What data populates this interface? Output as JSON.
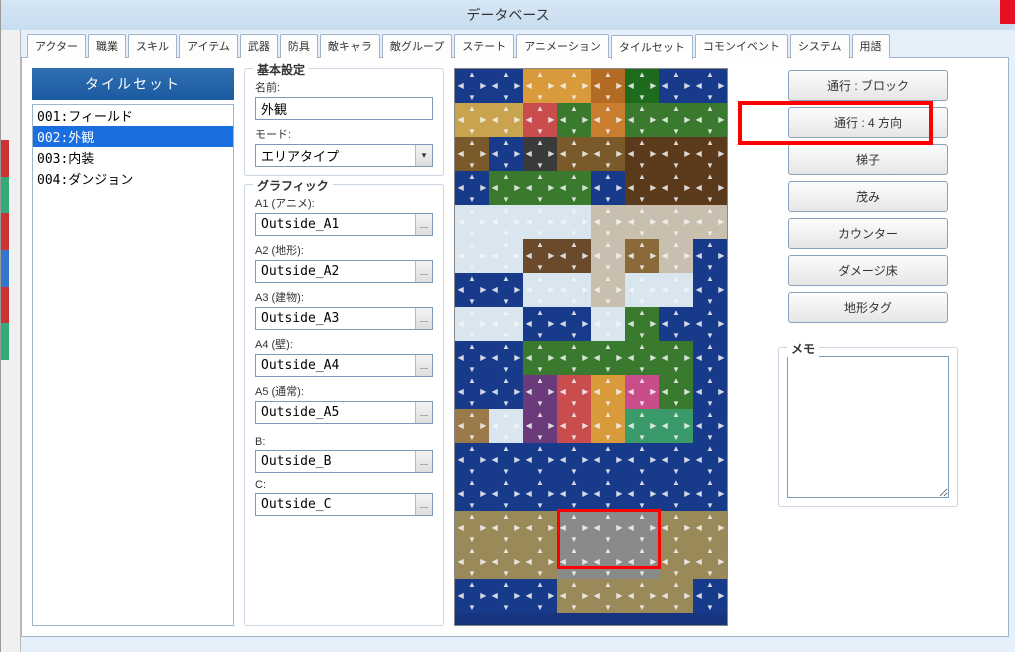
{
  "window": {
    "title": "データベース"
  },
  "tabs": {
    "items": [
      {
        "id": "actor",
        "label": "アクター"
      },
      {
        "id": "class",
        "label": "職業"
      },
      {
        "id": "skill",
        "label": "スキル"
      },
      {
        "id": "item",
        "label": "アイテム"
      },
      {
        "id": "weapon",
        "label": "武器"
      },
      {
        "id": "armor",
        "label": "防具"
      },
      {
        "id": "enemy",
        "label": "敵キャラ"
      },
      {
        "id": "troop",
        "label": "敵グループ"
      },
      {
        "id": "state",
        "label": "ステート"
      },
      {
        "id": "anim",
        "label": "アニメーション"
      },
      {
        "id": "tileset",
        "label": "タイルセット"
      },
      {
        "id": "common",
        "label": "コモンイベント"
      },
      {
        "id": "system",
        "label": "システム"
      },
      {
        "id": "terms",
        "label": "用語"
      }
    ],
    "active": "tileset"
  },
  "list": {
    "header": "タイルセット",
    "items": [
      {
        "id": "001",
        "label": "001:フィールド",
        "selected": false
      },
      {
        "id": "002",
        "label": "002:外観",
        "selected": true
      },
      {
        "id": "003",
        "label": "003:内装",
        "selected": false
      },
      {
        "id": "004",
        "label": "004:ダンジョン",
        "selected": false
      }
    ]
  },
  "basic": {
    "group_title": "基本設定",
    "name_label": "名前:",
    "name_value": "外観",
    "mode_label": "モード:",
    "mode_value": "エリアタイプ"
  },
  "graphic": {
    "group_title": "グラフィック",
    "fields": [
      {
        "label": "A1 (アニメ):",
        "value": "Outside_A1"
      },
      {
        "label": "A2 (地形):",
        "value": "Outside_A2"
      },
      {
        "label": "A3 (建物):",
        "value": "Outside_A3"
      },
      {
        "label": "A4 (壁):",
        "value": "Outside_A4"
      },
      {
        "label": "A5 (通常):",
        "value": "Outside_A5"
      },
      {
        "label": "B:",
        "value": "Outside_B"
      },
      {
        "label": "C:",
        "value": "Outside_C"
      }
    ]
  },
  "buttons": {
    "passage_block": "通行 : ブロック",
    "passage_4dir": "通行 : 4 方向",
    "ladder": "梯子",
    "bush": "茂み",
    "counter": "カウンター",
    "damage": "ダメージ床",
    "terrain": "地形タグ"
  },
  "memo": {
    "label": "メモ",
    "value": ""
  },
  "tile_palette": {
    "cols": 8,
    "rows": 16,
    "tiles": [
      [
        "#173a8a",
        "#173a8a",
        "#d89a3a",
        "#d89a3a",
        "#b36b23",
        "#1e6b1e",
        "#173a8a",
        "#173a8a"
      ],
      [
        "#c9a34d",
        "#c9a34d",
        "#c94d4d",
        "#3a7a2f",
        "#c97d2f",
        "#3a7a2f",
        "#3a7a2f",
        "#3a7a2f"
      ],
      [
        "#7a5a2a",
        "#173a8a",
        "#3a3a3a",
        "#7a5a2a",
        "#7a5a2a",
        "#5a3a1a",
        "#5a3a1a",
        "#5a3a1a"
      ],
      [
        "#173a8a",
        "#3a7a2f",
        "#3a7a2f",
        "#3a7a2f",
        "#173a8a",
        "#5a3a1a",
        "#5a3a1a",
        "#5a3a1a"
      ],
      [
        "#d9e6ef",
        "#d9e6ef",
        "#d9e6ef",
        "#d9e6ef",
        "#c9bfae",
        "#c9bfae",
        "#c9bfae",
        "#c9bfae"
      ],
      [
        "#d9e6ef",
        "#d9e6ef",
        "#6a4a2a",
        "#6a4a2a",
        "#c9bfae",
        "#8a6a3a",
        "#c9bfae",
        "#173a8a"
      ],
      [
        "#173a8a",
        "#173a8a",
        "#d9e6ef",
        "#d9e6ef",
        "#c9bfae",
        "#d9e6ef",
        "#d9e6ef",
        "#173a8a"
      ],
      [
        "#d9e6ef",
        "#d9e6ef",
        "#173a8a",
        "#173a8a",
        "#d9e6ef",
        "#3a7a2f",
        "#173a8a",
        "#173a8a"
      ],
      [
        "#173a8a",
        "#173a8a",
        "#3a7a2f",
        "#3a7a2f",
        "#3a7a2f",
        "#3a7a2f",
        "#3a7a2f",
        "#173a8a"
      ],
      [
        "#173a8a",
        "#173a8a",
        "#6a3a7a",
        "#c94d4d",
        "#d89a3a",
        "#c94d8a",
        "#3a7a2f",
        "#173a8a"
      ],
      [
        "#9a7a4a",
        "#d9e6ef",
        "#6a3a7a",
        "#c94d4d",
        "#d89a3a",
        "#3a9a6a",
        "#3a9a6a",
        "#173a8a"
      ],
      [
        "#173a8a",
        "#173a8a",
        "#173a8a",
        "#173a8a",
        "#173a8a",
        "#173a8a",
        "#173a8a",
        "#173a8a"
      ],
      [
        "#173a8a",
        "#173a8a",
        "#173a8a",
        "#173a8a",
        "#173a8a",
        "#173a8a",
        "#173a8a",
        "#173a8a"
      ],
      [
        "#9a8a5a",
        "#9a8a5a",
        "#9a8a5a",
        "#8a8a8a",
        "#8a8a8a",
        "#8a8a8a",
        "#9a8a5a",
        "#9a8a5a"
      ],
      [
        "#9a8a5a",
        "#9a8a5a",
        "#9a8a5a",
        "#8a8a8a",
        "#8a8a8a",
        "#8a8a8a",
        "#9a8a5a",
        "#9a8a5a"
      ],
      [
        "#173a8a",
        "#173a8a",
        "#173a8a",
        "#9a8a5a",
        "#9a8a5a",
        "#9a8a5a",
        "#9a8a5a",
        "#173a8a"
      ]
    ]
  }
}
